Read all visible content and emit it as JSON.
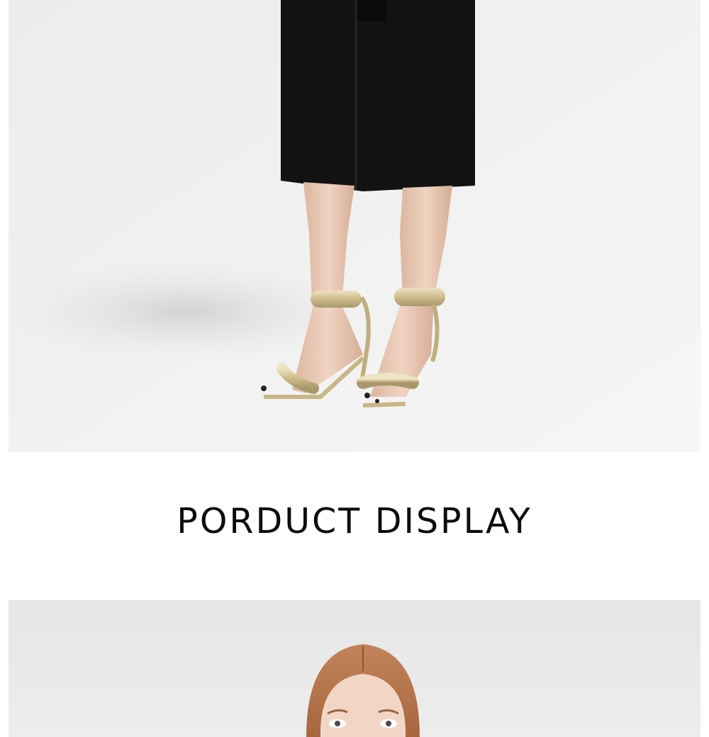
{
  "product_display": {
    "heading": "PORDUCT DISPLAY"
  },
  "images": {
    "top": "model-legs-gold-sandals-photo",
    "bottom": "model-portrait-photo"
  },
  "colors": {
    "backdrop": "#efefef",
    "coat": "#111111",
    "skin": "#e9c9b6",
    "sandal_gold": "#d3c49a",
    "hair": "#b8774e",
    "heading_text": "#0c0c0c"
  }
}
